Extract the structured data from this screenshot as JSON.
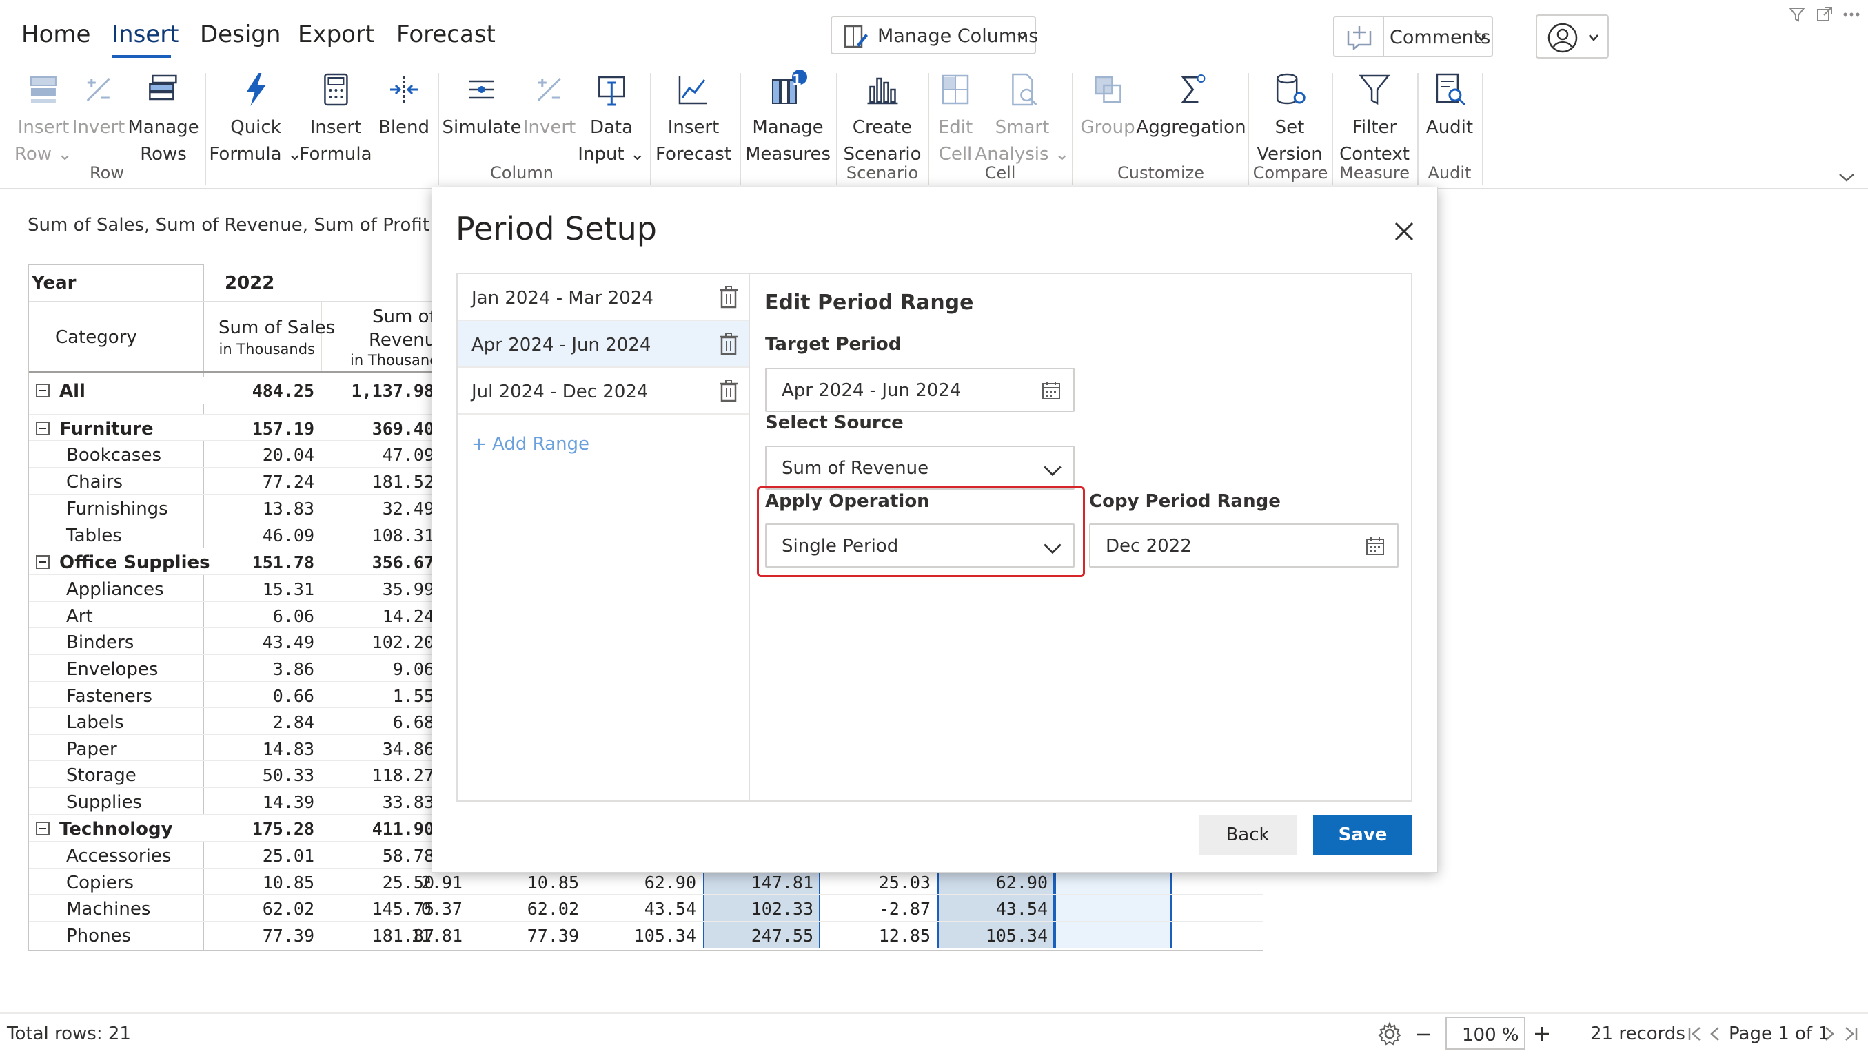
{
  "ribbon": {
    "tabs": [
      "Home",
      "Insert",
      "Design",
      "Export",
      "Forecast"
    ],
    "manage_columns": "Manage Columns",
    "comments": "Comments",
    "groups": {
      "row": "Row",
      "column": "Column",
      "scenario": "Scenario",
      "cell": "Cell",
      "customize": "Customize",
      "compare": "Compare",
      "measure": "Measure",
      "audit": "Audit"
    },
    "buttons": {
      "insert_row": [
        "Insert",
        "Row"
      ],
      "invert_row": [
        "Invert",
        ""
      ],
      "manage_rows": [
        "Manage",
        "Rows"
      ],
      "quick_formula": [
        "Quick",
        "Formula"
      ],
      "insert_formula": [
        "Insert",
        "Formula"
      ],
      "blend": [
        "Blend",
        ""
      ],
      "simulate": [
        "Simulate",
        ""
      ],
      "invert_col": [
        "Invert",
        ""
      ],
      "data_input": [
        "Data",
        "Input"
      ],
      "insert_forecast": [
        "Insert",
        "Forecast"
      ],
      "manage_measures": [
        "Manage",
        "Measures"
      ],
      "manage_measures_badge": "1",
      "create_scenario": [
        "Create",
        "Scenario"
      ],
      "edit_cell": [
        "Edit",
        "Cell"
      ],
      "smart_analysis": [
        "Smart",
        "Analysis"
      ],
      "group": [
        "Group",
        ""
      ],
      "aggregation": [
        "Aggregation",
        ""
      ],
      "set_version": [
        "Set",
        "Version"
      ],
      "filter_context": [
        "Filter",
        "Context"
      ],
      "audit": [
        "Audit",
        ""
      ]
    }
  },
  "report": {
    "title": "Sum of Sales, Sum of Revenue, Sum of Profit by Categ",
    "year_label": "Year",
    "year_value": "2022",
    "category_label": "Category",
    "col_sales": "Sum of Sales",
    "col_sales_sub": "in Thousands",
    "col_revenue_1": "Sum of",
    "col_revenue_2": "Revenue",
    "col_revenue_sub": "in Thousands",
    "rows": [
      {
        "name": "All",
        "bold": true,
        "expander": true,
        "indent": 0,
        "sales": "484.25",
        "revenue": "1,137.98"
      },
      {
        "name": "Furniture",
        "bold": true,
        "expander": true,
        "indent": 0,
        "sales": "157.19",
        "revenue": "369.40"
      },
      {
        "name": "Bookcases",
        "indent": 1,
        "sales": "20.04",
        "revenue": "47.09"
      },
      {
        "name": "Chairs",
        "indent": 1,
        "sales": "77.24",
        "revenue": "181.52"
      },
      {
        "name": "Furnishings",
        "indent": 1,
        "sales": "13.83",
        "revenue": "32.49"
      },
      {
        "name": "Tables",
        "indent": 1,
        "sales": "46.09",
        "revenue": "108.31"
      },
      {
        "name": "Office Supplies",
        "bold": true,
        "expander": true,
        "indent": 0,
        "sales": "151.78",
        "revenue": "356.67"
      },
      {
        "name": "Appliances",
        "indent": 1,
        "sales": "15.31",
        "revenue": "35.99"
      },
      {
        "name": "Art",
        "indent": 1,
        "sales": "6.06",
        "revenue": "14.24"
      },
      {
        "name": "Binders",
        "indent": 1,
        "sales": "43.49",
        "revenue": "102.20"
      },
      {
        "name": "Envelopes",
        "indent": 1,
        "sales": "3.86",
        "revenue": "9.06"
      },
      {
        "name": "Fasteners",
        "indent": 1,
        "sales": "0.66",
        "revenue": "1.55"
      },
      {
        "name": "Labels",
        "indent": 1,
        "sales": "2.84",
        "revenue": "6.68"
      },
      {
        "name": "Paper",
        "indent": 1,
        "sales": "14.83",
        "revenue": "34.86"
      },
      {
        "name": "Storage",
        "indent": 1,
        "sales": "50.33",
        "revenue": "118.27"
      },
      {
        "name": "Supplies",
        "indent": 1,
        "sales": "14.39",
        "revenue": "33.83"
      },
      {
        "name": "Technology",
        "bold": true,
        "expander": true,
        "indent": 0,
        "sales": "175.28",
        "revenue": "411.90"
      },
      {
        "name": "Accessories",
        "indent": 1,
        "sales": "25.01",
        "revenue": "58.78"
      },
      {
        "name": "Copiers",
        "indent": 1,
        "sales": "10.85",
        "revenue": "25.50",
        "extra": [
          "2.91",
          "10.85",
          "62.90",
          "147.81",
          "25.03",
          "62.90",
          ""
        ]
      },
      {
        "name": "Machines",
        "indent": 1,
        "sales": "62.02",
        "revenue": "145.75",
        "extra": [
          "0.37",
          "62.02",
          "43.54",
          "102.33",
          "-2.87",
          "43.54",
          ""
        ]
      },
      {
        "name": "Phones",
        "indent": 1,
        "sales": "77.39",
        "revenue": "181.87",
        "extra": [
          "11.81",
          "77.39",
          "105.34",
          "247.55",
          "12.85",
          "105.34",
          ""
        ]
      }
    ]
  },
  "dialog": {
    "title": "Period Setup",
    "ranges": [
      "Jan 2024 - Mar 2024",
      "Apr 2024 - Jun 2024",
      "Jul 2024 - Dec 2024"
    ],
    "selected_range_index": 1,
    "add_range": "+ Add Range",
    "edit_heading": "Edit Period Range",
    "target_period_label": "Target Period",
    "target_period_value": "Apr 2024 - Jun 2024",
    "select_source_label": "Select Source",
    "select_source_value": "Sum of Revenue",
    "apply_operation_label": "Apply Operation",
    "apply_operation_value": "Single Period",
    "copy_period_label": "Copy Period Range",
    "copy_period_value": "Dec 2022",
    "back": "Back",
    "save": "Save"
  },
  "status": {
    "total_rows": "Total rows: 21",
    "zoom": "100 %",
    "records": "21 records",
    "page": "Page 1 of 1"
  },
  "colors": {
    "accent": "#0f6cbd",
    "highlight_border": "#d6262b",
    "selected_row": "#eaf2fb",
    "cell_highlight": "#cfdcea"
  }
}
